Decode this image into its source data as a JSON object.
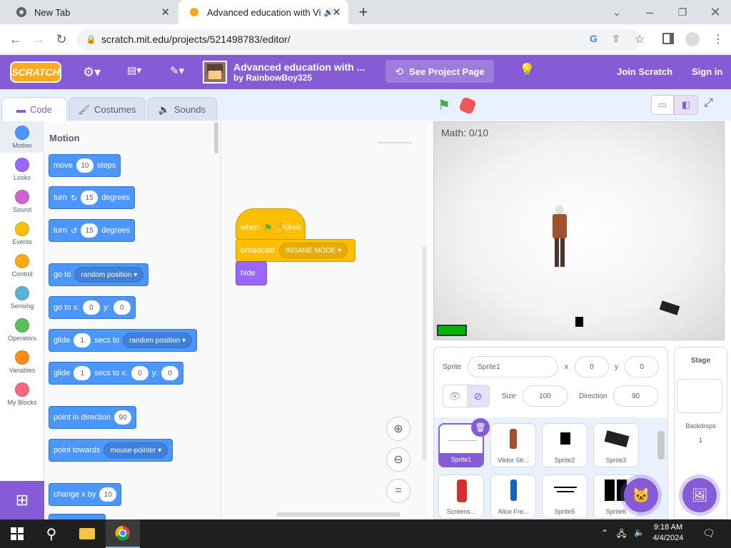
{
  "browser": {
    "tabs": [
      {
        "title": "New Tab"
      },
      {
        "title": "Advanced education with Vi"
      }
    ],
    "url": "scratch.mit.edu/projects/521498783/editor/"
  },
  "menu": {
    "logo": "SCRATCH",
    "project_title": "Advanced education with ...",
    "author": "by RainbowBoy325",
    "see_project_page": "See Project Page",
    "join": "Join Scratch",
    "signin": "Sign in"
  },
  "editor_tabs": {
    "code": "Code",
    "costumes": "Costumes",
    "sounds": "Sounds"
  },
  "categories": [
    {
      "label": "Motion",
      "color": "#4c97ff"
    },
    {
      "label": "Looks",
      "color": "#9966ff"
    },
    {
      "label": "Sound",
      "color": "#cf63cf"
    },
    {
      "label": "Events",
      "color": "#ffbf00"
    },
    {
      "label": "Control",
      "color": "#ffab19"
    },
    {
      "label": "Sensing",
      "color": "#5cb1d6"
    },
    {
      "label": "Operators",
      "color": "#59c059"
    },
    {
      "label": "Variables",
      "color": "#ff8c1a"
    },
    {
      "label": "My Blocks",
      "color": "#ff6680"
    }
  ],
  "palette": {
    "heading": "Motion",
    "move": {
      "a": "move",
      "v": "10",
      "b": "steps"
    },
    "turn_cw": {
      "a": "turn",
      "v": "15",
      "b": "degrees"
    },
    "turn_ccw": {
      "a": "turn",
      "v": "15",
      "b": "degrees"
    },
    "goto": {
      "a": "go to",
      "d": "random position"
    },
    "gotoxy": {
      "a": "go to x:",
      "x": "0",
      "b": "y:",
      "y": "0"
    },
    "glide_to": {
      "a": "glide",
      "v": "1",
      "b": "secs to",
      "d": "random position"
    },
    "glide_xy": {
      "a": "glide",
      "v": "1",
      "b": "secs to x:",
      "x": "0",
      "c": "y:",
      "y": "0"
    },
    "point_dir": {
      "a": "point in direction",
      "v": "90"
    },
    "point_towards": {
      "a": "point towards",
      "d": "mouse-pointer"
    },
    "change_x": {
      "a": "change x by",
      "v": "10"
    }
  },
  "script": {
    "when": "when",
    "clicked": "clicked",
    "broadcast": "broadcast",
    "broadcast_value": "INSANE MODE",
    "hide": "hide"
  },
  "stage": {
    "variable_monitor": "Math: 0/10"
  },
  "sprite_info": {
    "sprite_label": "Sprite",
    "sprite_name": "Sprite1",
    "x_label": "x",
    "x": "0",
    "y_label": "y",
    "y": "0",
    "show_label": "Show",
    "size_label": "Size",
    "size": "100",
    "direction_label": "Direction",
    "direction": "90"
  },
  "sprites": [
    "Sprite1",
    "Viktor Str...",
    "Sprite2",
    "Sprite3",
    "Screens...",
    "Alice Fre...",
    "Sprite5",
    "Sprite6"
  ],
  "stage_pane": {
    "title": "Stage",
    "backdrops_label": "Backdrops",
    "backdrops_count": "1"
  },
  "taskbar": {
    "time": "9:18 AM",
    "date": "4/4/2024"
  }
}
